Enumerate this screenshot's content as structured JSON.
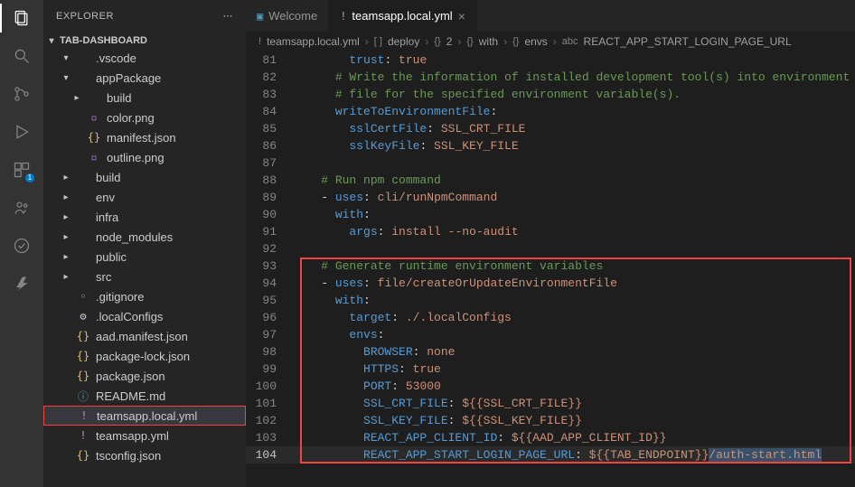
{
  "sidebar": {
    "title": "EXPLORER",
    "section": "TAB-DASHBOARD",
    "items": [
      {
        "indent": 1,
        "chev": "▾",
        "icon": "",
        "label": ".vscode",
        "cls": ""
      },
      {
        "indent": 1,
        "chev": "▾",
        "icon": "",
        "label": "appPackage",
        "cls": ""
      },
      {
        "indent": 2,
        "chev": "▸",
        "icon": "",
        "label": "build",
        "cls": ""
      },
      {
        "indent": 2,
        "chev": "",
        "icon": "▫",
        "label": "color.png",
        "cls": "fc-purple"
      },
      {
        "indent": 2,
        "chev": "",
        "icon": "{}",
        "label": "manifest.json",
        "cls": "fc-yellow"
      },
      {
        "indent": 2,
        "chev": "",
        "icon": "▫",
        "label": "outline.png",
        "cls": "fc-purple"
      },
      {
        "indent": 1,
        "chev": "▸",
        "icon": "",
        "label": "build",
        "cls": ""
      },
      {
        "indent": 1,
        "chev": "▸",
        "icon": "",
        "label": "env",
        "cls": ""
      },
      {
        "indent": 1,
        "chev": "▸",
        "icon": "",
        "label": "infra",
        "cls": ""
      },
      {
        "indent": 1,
        "chev": "▸",
        "icon": "",
        "label": "node_modules",
        "cls": ""
      },
      {
        "indent": 1,
        "chev": "▸",
        "icon": "",
        "label": "public",
        "cls": ""
      },
      {
        "indent": 1,
        "chev": "▸",
        "icon": "",
        "label": "src",
        "cls": ""
      },
      {
        "indent": 1,
        "chev": "",
        "icon": "◦",
        "label": ".gitignore",
        "cls": ""
      },
      {
        "indent": 1,
        "chev": "",
        "icon": "⚙",
        "label": ".localConfigs",
        "cls": ""
      },
      {
        "indent": 1,
        "chev": "",
        "icon": "{}",
        "label": "aad.manifest.json",
        "cls": "fc-yellow"
      },
      {
        "indent": 1,
        "chev": "",
        "icon": "{}",
        "label": "package-lock.json",
        "cls": "fc-yellow"
      },
      {
        "indent": 1,
        "chev": "",
        "icon": "{}",
        "label": "package.json",
        "cls": "fc-yellow"
      },
      {
        "indent": 1,
        "chev": "",
        "icon": "ⓘ",
        "label": "README.md",
        "cls": "fc-blue"
      },
      {
        "indent": 1,
        "chev": "",
        "icon": "!",
        "label": "teamsapp.local.yml",
        "cls": "fc-mag",
        "selected": true
      },
      {
        "indent": 1,
        "chev": "",
        "icon": "!",
        "label": "teamsapp.yml",
        "cls": "fc-mag"
      },
      {
        "indent": 1,
        "chev": "",
        "icon": "{}",
        "label": "tsconfig.json",
        "cls": "fc-yellow"
      }
    ]
  },
  "tabs": [
    {
      "icon": "▣",
      "label": "Welcome",
      "active": false
    },
    {
      "icon": "!",
      "label": "teamsapp.local.yml",
      "active": true,
      "close": "×"
    }
  ],
  "breadcrumbs": [
    {
      "icon": "!",
      "text": "teamsapp.local.yml"
    },
    {
      "icon": "[ ]",
      "text": "deploy"
    },
    {
      "icon": "{}",
      "text": "2"
    },
    {
      "icon": "{}",
      "text": "with"
    },
    {
      "icon": "{}",
      "text": "envs"
    },
    {
      "icon": "abc",
      "text": "REACT_APP_START_LOGIN_PAGE_URL"
    }
  ],
  "editor": {
    "lines": [
      {
        "n": 81,
        "ind": 8,
        "segs": [
          {
            "t": "trust",
            "c": "tok-key"
          },
          {
            "t": ": ",
            "c": "tok-punc"
          },
          {
            "t": "true",
            "c": "tok-str"
          }
        ]
      },
      {
        "n": 82,
        "ind": 6,
        "segs": [
          {
            "t": "# Write the information of installed development tool(s) into environment",
            "c": "tok-com"
          }
        ]
      },
      {
        "n": 83,
        "ind": 6,
        "segs": [
          {
            "t": "# file for the specified environment variable(s).",
            "c": "tok-com"
          }
        ]
      },
      {
        "n": 84,
        "ind": 6,
        "segs": [
          {
            "t": "writeToEnvironmentFile",
            "c": "tok-key"
          },
          {
            "t": ":",
            "c": "tok-punc"
          }
        ]
      },
      {
        "n": 85,
        "ind": 8,
        "segs": [
          {
            "t": "sslCertFile",
            "c": "tok-key"
          },
          {
            "t": ": ",
            "c": "tok-punc"
          },
          {
            "t": "SSL_CRT_FILE",
            "c": "tok-str"
          }
        ]
      },
      {
        "n": 86,
        "ind": 8,
        "segs": [
          {
            "t": "sslKeyFile",
            "c": "tok-key"
          },
          {
            "t": ": ",
            "c": "tok-punc"
          },
          {
            "t": "SSL_KEY_FILE",
            "c": "tok-str"
          }
        ]
      },
      {
        "n": 87,
        "ind": 0,
        "segs": []
      },
      {
        "n": 88,
        "ind": 4,
        "segs": [
          {
            "t": "# Run npm command",
            "c": "tok-com"
          }
        ]
      },
      {
        "n": 89,
        "ind": 4,
        "segs": [
          {
            "t": "- ",
            "c": "tok-punc"
          },
          {
            "t": "uses",
            "c": "tok-key"
          },
          {
            "t": ": ",
            "c": "tok-punc"
          },
          {
            "t": "cli/runNpmCommand",
            "c": "tok-str"
          }
        ]
      },
      {
        "n": 90,
        "ind": 6,
        "segs": [
          {
            "t": "with",
            "c": "tok-key"
          },
          {
            "t": ":",
            "c": "tok-punc"
          }
        ]
      },
      {
        "n": 91,
        "ind": 8,
        "segs": [
          {
            "t": "args",
            "c": "tok-key"
          },
          {
            "t": ": ",
            "c": "tok-punc"
          },
          {
            "t": "install --no-audit",
            "c": "tok-str"
          }
        ]
      },
      {
        "n": 92,
        "ind": 0,
        "segs": []
      },
      {
        "n": 93,
        "ind": 4,
        "segs": [
          {
            "t": "# Generate runtime environment variables",
            "c": "tok-com"
          }
        ],
        "boxtop": true
      },
      {
        "n": 94,
        "ind": 4,
        "segs": [
          {
            "t": "- ",
            "c": "tok-punc"
          },
          {
            "t": "uses",
            "c": "tok-key"
          },
          {
            "t": ": ",
            "c": "tok-punc"
          },
          {
            "t": "file/createOrUpdateEnvironmentFile",
            "c": "tok-str"
          }
        ]
      },
      {
        "n": 95,
        "ind": 6,
        "segs": [
          {
            "t": "with",
            "c": "tok-key"
          },
          {
            "t": ":",
            "c": "tok-punc"
          }
        ]
      },
      {
        "n": 96,
        "ind": 8,
        "segs": [
          {
            "t": "target",
            "c": "tok-key"
          },
          {
            "t": ": ",
            "c": "tok-punc"
          },
          {
            "t": "./.localConfigs",
            "c": "tok-str"
          }
        ]
      },
      {
        "n": 97,
        "ind": 8,
        "segs": [
          {
            "t": "envs",
            "c": "tok-key"
          },
          {
            "t": ":",
            "c": "tok-punc"
          }
        ]
      },
      {
        "n": 98,
        "ind": 10,
        "segs": [
          {
            "t": "BROWSER",
            "c": "tok-key"
          },
          {
            "t": ": ",
            "c": "tok-punc"
          },
          {
            "t": "none",
            "c": "tok-str"
          }
        ]
      },
      {
        "n": 99,
        "ind": 10,
        "segs": [
          {
            "t": "HTTPS",
            "c": "tok-key"
          },
          {
            "t": ": ",
            "c": "tok-punc"
          },
          {
            "t": "true",
            "c": "tok-str"
          }
        ]
      },
      {
        "n": 100,
        "ind": 10,
        "segs": [
          {
            "t": "PORT",
            "c": "tok-key"
          },
          {
            "t": ": ",
            "c": "tok-punc"
          },
          {
            "t": "53000",
            "c": "tok-str"
          }
        ]
      },
      {
        "n": 101,
        "ind": 10,
        "segs": [
          {
            "t": "SSL_CRT_FILE",
            "c": "tok-key"
          },
          {
            "t": ": ",
            "c": "tok-punc"
          },
          {
            "t": "${{SSL_CRT_FILE}}",
            "c": "tok-str"
          }
        ]
      },
      {
        "n": 102,
        "ind": 10,
        "segs": [
          {
            "t": "SSL_KEY_FILE",
            "c": "tok-key"
          },
          {
            "t": ": ",
            "c": "tok-punc"
          },
          {
            "t": "${{SSL_KEY_FILE}}",
            "c": "tok-str"
          }
        ]
      },
      {
        "n": 103,
        "ind": 10,
        "segs": [
          {
            "t": "REACT_APP_CLIENT_ID",
            "c": "tok-key"
          },
          {
            "t": ": ",
            "c": "tok-punc"
          },
          {
            "t": "${{AAD_APP_CLIENT_ID}}",
            "c": "tok-str"
          }
        ]
      },
      {
        "n": 104,
        "ind": 10,
        "segs": [
          {
            "t": "REACT_APP_START_LOGIN_PAGE_URL",
            "c": "tok-key"
          },
          {
            "t": ": ",
            "c": "tok-punc"
          },
          {
            "t": "${{TAB_ENDPOINT}}",
            "c": "tok-str"
          },
          {
            "t": "/auth-start.html",
            "c": "tok-str",
            "sel": true
          }
        ],
        "current": true
      }
    ],
    "highlight": {
      "startLine": 93,
      "endLine": 104
    }
  },
  "activity": {
    "badge": "1"
  }
}
